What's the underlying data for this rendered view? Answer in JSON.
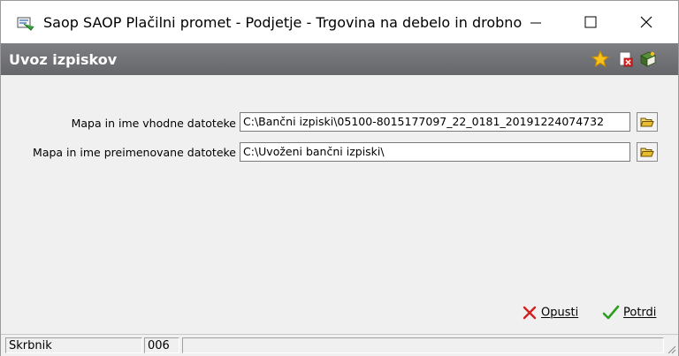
{
  "window": {
    "title": "Saop SAOP Plačilni promet - Podjetje - Trgovina na debelo in drobno"
  },
  "header": {
    "title": "Uvoz izpiskov",
    "icons": [
      "favorite-star-icon",
      "exit-icon",
      "help-book-icon"
    ]
  },
  "form": {
    "source_label": "Mapa in ime vhodne datoteke",
    "source_value": "C:\\Bančni izpiski\\05100-8015177097_22_0181_20191224074732",
    "renamed_label": "Mapa in ime preimenovane datoteke",
    "renamed_value": "C:\\Uvoženi bančni izpiski\\"
  },
  "actions": {
    "cancel_label": "Opusti",
    "confirm_label": "Potrdi"
  },
  "statusbar": {
    "user": "Skrbnik",
    "code": "006"
  },
  "colors": {
    "header_bg": "#727376",
    "cancel_icon": "#d42020",
    "confirm_icon": "#2e9e1e"
  }
}
